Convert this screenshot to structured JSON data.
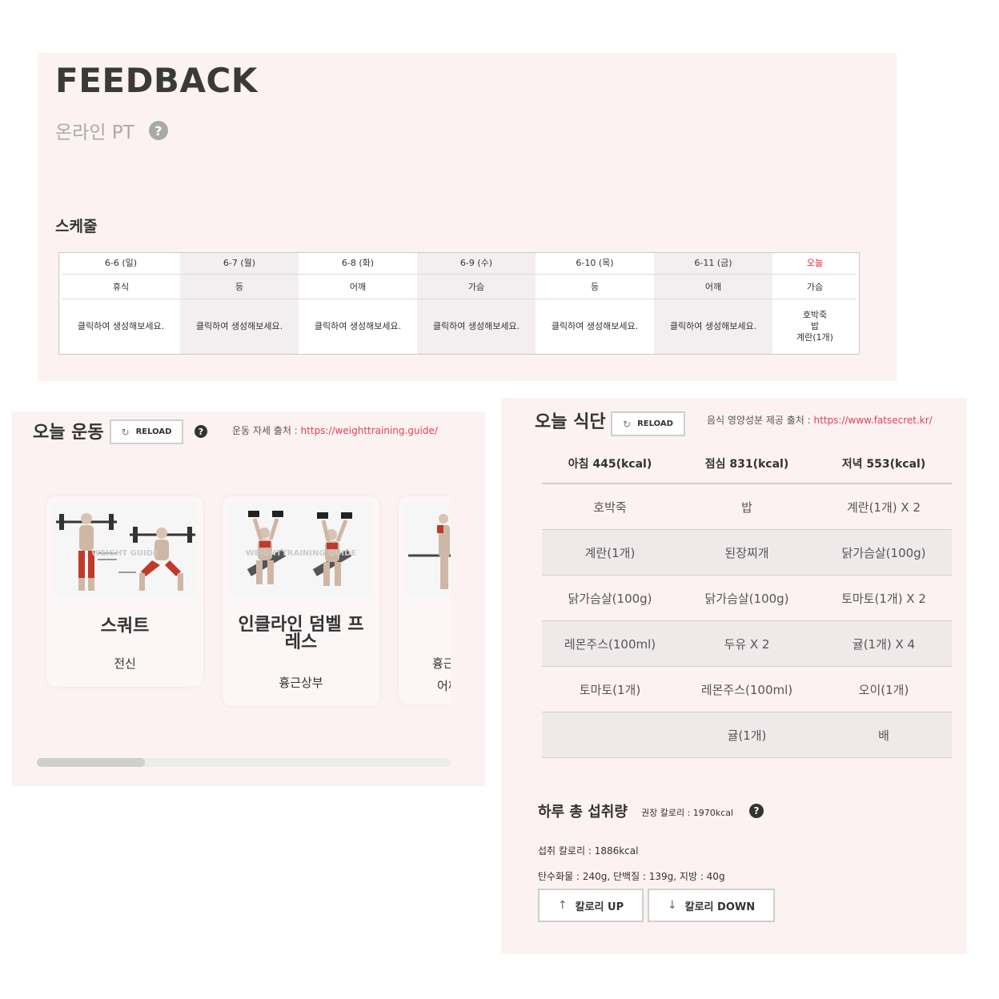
{
  "feedback": {
    "title": "FEEDBACK",
    "subtitle": "온라인 PT",
    "help_glyph": "?",
    "schedule_title": "스케줄",
    "schedule": [
      {
        "date": "6-6 (일)",
        "part": "휴식",
        "meal": "클릭하여 생성해보세요."
      },
      {
        "date": "6-7 (월)",
        "part": "등",
        "meal": "클릭하여 생성해보세요."
      },
      {
        "date": "6-8 (화)",
        "part": "어깨",
        "meal": "클릭하여 생성해보세요."
      },
      {
        "date": "6-9 (수)",
        "part": "가슴",
        "meal": "클릭하여 생성해보세요."
      },
      {
        "date": "6-10 (목)",
        "part": "등",
        "meal": "클릭하여 생성해보세요."
      },
      {
        "date": "6-11 (금)",
        "part": "어깨",
        "meal": "클릭하여 생성해보세요."
      },
      {
        "date": "오늘",
        "part": "가슴",
        "meal_lines": [
          "호박죽",
          "밥",
          "계란(1개)"
        ]
      }
    ],
    "today_color": "#e0202a"
  },
  "exercise": {
    "title": "오늘 운동",
    "reload_label": "RELOAD",
    "help_glyph": "?",
    "source_prefix": "운동 자세 출처 : ",
    "source_link": "https://weighttraining.guide/",
    "cards": [
      {
        "name": "스쿼트",
        "target": "전신",
        "icon": "squat-illustration"
      },
      {
        "name": "인클라인 덤벨 프레스",
        "name_lines": [
          "인클라인 덤벨 프",
          "레스"
        ],
        "target": "흉근상부",
        "icon": "incline-dumbbell-press-illustration"
      },
      {
        "name_partial": "흉근",
        "target_partial": "어깨",
        "icon": "partial-exercise-illustration"
      }
    ],
    "scroll_position": 0
  },
  "diet": {
    "title": "오늘 식단",
    "reload_label": "RELOAD",
    "source_prefix": "음식 영양성분 제공 출처 : ",
    "source_link": "https://www.fatsecret.kr/",
    "columns": [
      "아침 445(kcal)",
      "점심 831(kcal)",
      "저녁 553(kcal)"
    ],
    "rows": [
      [
        "호박죽",
        "밥",
        "계란(1개) X 2"
      ],
      [
        "계란(1개)",
        "된장찌개",
        "닭가슴살(100g)"
      ],
      [
        "닭가슴살(100g)",
        "닭가슴살(100g)",
        "토마토(1개) X 2"
      ],
      [
        "레몬주스(100ml)",
        "두유 X 2",
        "귤(1개) X 4"
      ],
      [
        "토마토(1개)",
        "레몬주스(100ml)",
        "오이(1개)"
      ],
      [
        "",
        "귤(1개)",
        "배"
      ]
    ],
    "intake_title": "하루 총 섭취량",
    "recommended": "권장 칼로리 : 1970kcal",
    "help_glyph": "?",
    "intake_calories": "섭취 칼로리 : 1886kcal",
    "macros": "탄수화물 : 240g, 단백질 : 139g, 지방 : 40g",
    "btn_up": "칼로리 UP",
    "btn_down": "칼로리 DOWN"
  },
  "colors": {
    "panel_bg": "#fdf2f2",
    "link": "#e0405a",
    "muscle_highlight": "#c0392b"
  }
}
